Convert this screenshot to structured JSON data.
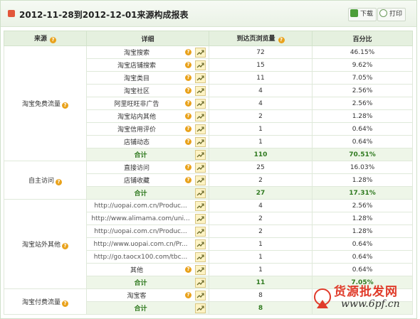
{
  "header": {
    "title": "2012-11-28到2012-12-01来源构成报表",
    "download_label": "下载",
    "print_label": "打印"
  },
  "table": {
    "columns": [
      "来源",
      "详细",
      "到达页浏览量",
      "百分比"
    ],
    "rows": [
      {
        "source": "淘宝免费流量",
        "detail": "淘宝搜索",
        "views": "72",
        "pct": "46.15%"
      },
      {
        "detail": "淘宝店铺搜索",
        "views": "15",
        "pct": "9.62%"
      },
      {
        "detail": "淘宝类目",
        "views": "11",
        "pct": "7.05%"
      },
      {
        "detail": "淘宝社区",
        "views": "4",
        "pct": "2.56%"
      },
      {
        "detail": "阿里旺旺非广告",
        "views": "4",
        "pct": "2.56%"
      },
      {
        "detail": "淘宝站内其他",
        "views": "2",
        "pct": "1.28%"
      },
      {
        "detail": "淘宝信用评价",
        "views": "1",
        "pct": "0.64%"
      },
      {
        "detail": "店铺动态",
        "views": "1",
        "pct": "0.64%"
      },
      {
        "detail": "合计",
        "views": "110",
        "pct": "70.51%",
        "total": true
      },
      {
        "source": "自主访问",
        "detail": "直接访问",
        "views": "25",
        "pct": "16.03%"
      },
      {
        "detail": "店铺收藏",
        "views": "2",
        "pct": "1.28%"
      },
      {
        "detail": "合计",
        "views": "27",
        "pct": "17.31%",
        "total": true
      },
      {
        "source": "淘宝站外其他",
        "detail": "http://uopai.com.cn/Produc...",
        "views": "4",
        "pct": "2.56%",
        "url": true
      },
      {
        "detail": "http://www.alimama.com/uni...",
        "views": "2",
        "pct": "1.28%",
        "url": true
      },
      {
        "detail": "http://uopai.com.cn/Produc...",
        "views": "2",
        "pct": "1.28%",
        "url": true
      },
      {
        "detail": "http://www.uopai.com.cn/Pr...",
        "views": "1",
        "pct": "0.64%",
        "url": true
      },
      {
        "detail": "http://go.taocx100.com/tbc...",
        "views": "1",
        "pct": "0.64%",
        "url": true
      },
      {
        "detail": "其他",
        "views": "1",
        "pct": "0.64%"
      },
      {
        "detail": "合计",
        "views": "11",
        "pct": "7.05%",
        "total": true
      },
      {
        "source": "淘宝付费流量",
        "detail": "淘宝客",
        "views": "8",
        "pct": "",
        "plain_icons": true
      },
      {
        "detail": "合计",
        "views": "8",
        "pct": "",
        "total": true
      }
    ]
  },
  "watermark": {
    "line1": "货源批发网",
    "line2": "www.6pf.cn"
  },
  "colors": {
    "header_bg": "#eaf2e6",
    "total_text": "#2f7a1f",
    "help_icon": "#e9a21b",
    "watermark_red": "#e03b2a"
  }
}
